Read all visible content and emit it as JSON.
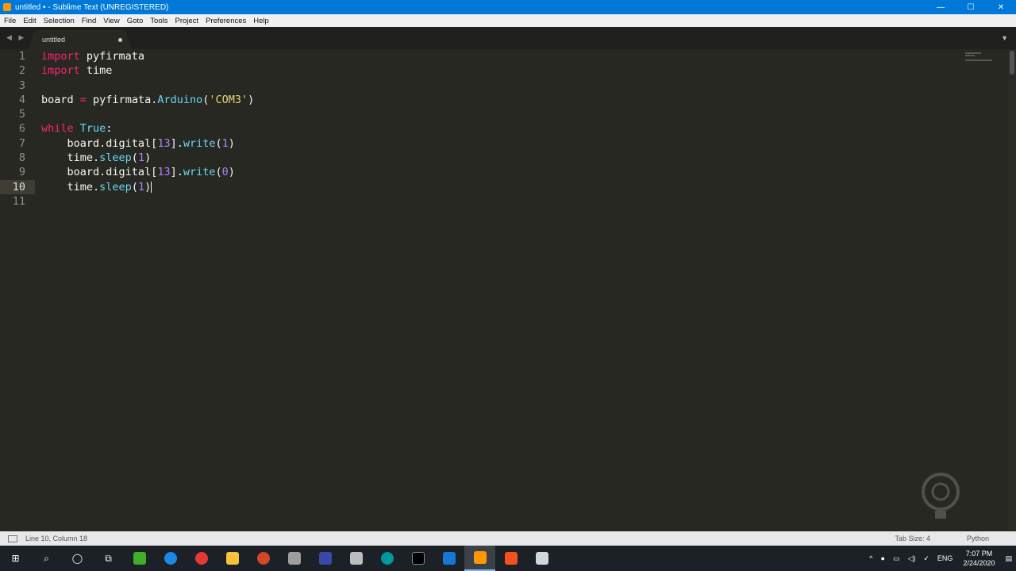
{
  "window": {
    "title": "untitled • - Sublime Text (UNREGISTERED)",
    "minimize": "—",
    "maximize": "☐",
    "close": "✕"
  },
  "menu": [
    "File",
    "Edit",
    "Selection",
    "Find",
    "View",
    "Goto",
    "Tools",
    "Project",
    "Preferences",
    "Help"
  ],
  "tabs": {
    "nav": "◀ ▶",
    "active_tab": "untitled",
    "dropdown": "▼"
  },
  "editor": {
    "line_numbers": [
      "1",
      "2",
      "3",
      "4",
      "5",
      "6",
      "7",
      "8",
      "9",
      "10",
      "11"
    ],
    "active_line": 10,
    "code_lines": [
      "import pyfirmata",
      "import time",
      "",
      "board = pyfirmata.Arduino('COM3')",
      "",
      "while True:",
      "    board.digital[13].write(1)",
      "    time.sleep(1)",
      "    board.digital[13].write(0)",
      "    time.sleep(1)",
      ""
    ]
  },
  "status": {
    "cursor_position": "Line 10, Column 18",
    "tab_size": "Tab Size: 4",
    "syntax": "Python"
  },
  "taskbar": {
    "tray_lang": "ENG",
    "time": "7:07 PM",
    "date": "2/24/2020"
  },
  "colors": {
    "keyword": "#f92672",
    "builtin": "#66d9ef",
    "number": "#ae81ff",
    "string": "#e6db74",
    "background": "#272822"
  }
}
